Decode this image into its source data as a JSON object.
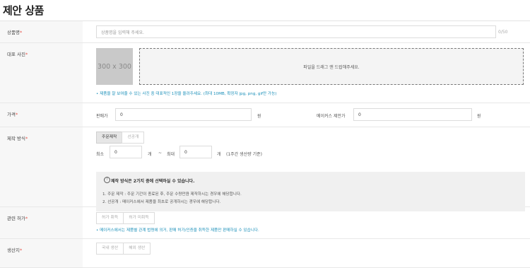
{
  "page_title": "제안 상품",
  "product_name": {
    "label": "상품명",
    "required_mark": "*",
    "placeholder": "상품명을 입력해 주세요.",
    "counter": "0/50"
  },
  "photo": {
    "label": "대표 사진",
    "required_mark": "*",
    "thumbnail_text": "300 x 300",
    "drop_text": "파일을 드래그 앤 드랍해주세요.",
    "hint": "• 제품을 잘 보여줄 수 있는 사진 중 대표적인 1장을 올려주세요. (최대 10MB, 확장자 jpg, png, gif만 가능)"
  },
  "price": {
    "label": "가격",
    "required_mark": "*",
    "sale_label": "판매가",
    "sale_value": "0",
    "sale_unit": "원",
    "offer_label": "메이커스 제안가",
    "offer_value": "0",
    "offer_unit": "원"
  },
  "production": {
    "label": "제작 방식",
    "required_mark": "*",
    "options": [
      "주문제작",
      "선공개"
    ],
    "selected": "주문제작",
    "min_label": "최소",
    "min_value": "0",
    "min_unit": "개",
    "separator": "~",
    "max_label": "최대",
    "max_value": "0",
    "max_unit": "개",
    "note": "(1주간 생산량 기준)",
    "info_title": "제작 방식은 2가지 중에 선택하실 수 있습니다.",
    "info_lines": [
      "1. 주문 제작 : 주문 기간이 종료된 후, 주문 수량만큼 제작하시는 경우에 해당합니다.",
      "2. 선공개 : 메이커스에서 제품을 최초로 공개하시는 경우에 해당합니다."
    ]
  },
  "permit": {
    "label": "관련 허가",
    "required_mark": "*",
    "options": [
      "허가 취득",
      "허가 미취득"
    ],
    "hint": "• 메이커스에서는 제품별 관계 법령에 의거, 판매 허가/인증을 취득한 제품만 판매하실 수 있습니다."
  },
  "origin": {
    "label": "생산지",
    "required_mark": "*",
    "options": [
      "국내 생산",
      "해외 생산"
    ]
  }
}
